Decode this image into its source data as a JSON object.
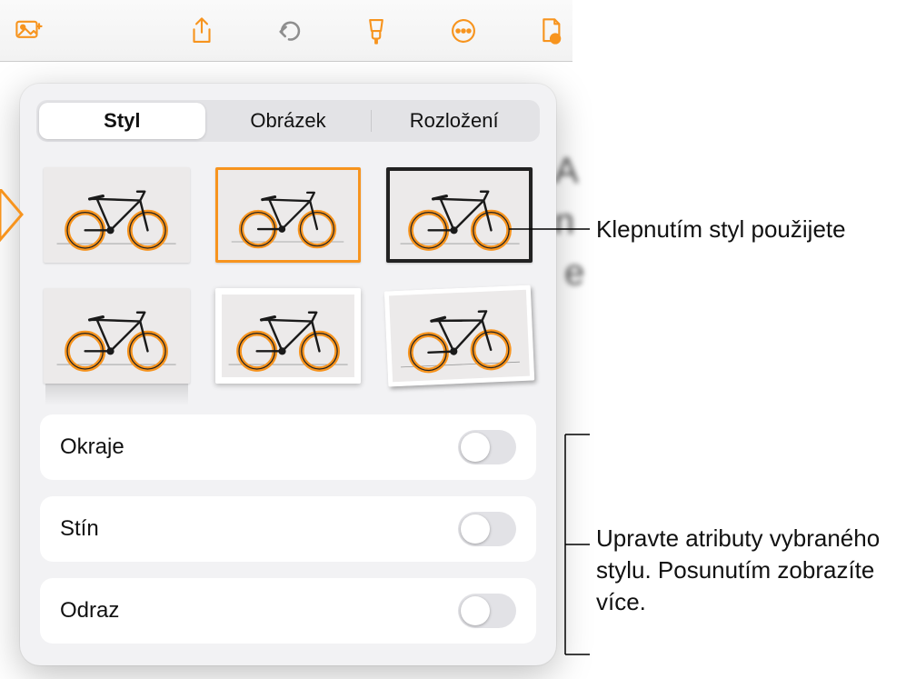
{
  "toolbar": {
    "media_icon": "media-icon",
    "share_icon": "share-icon",
    "undo_icon": "undo-icon",
    "brush_icon": "brush-icon",
    "more_icon": "more-icon",
    "document_icon": "document-view-icon"
  },
  "tabs": {
    "style": "Styl",
    "image": "Obrázek",
    "layout": "Rozložení",
    "selected": "style"
  },
  "style_thumbs": [
    {
      "id": "style-plain",
      "variant": "plain"
    },
    {
      "id": "style-bordered",
      "variant": "bordered"
    },
    {
      "id": "style-frame-dark",
      "variant": "frame-dark"
    },
    {
      "id": "style-reflection",
      "variant": "reflection"
    },
    {
      "id": "style-frame-white",
      "variant": "frame-white"
    },
    {
      "id": "style-tilt",
      "variant": "tilt"
    }
  ],
  "options": {
    "border": {
      "label": "Okraje",
      "value": false
    },
    "shadow": {
      "label": "Stín",
      "value": false
    },
    "reflect": {
      "label": "Odraz",
      "value": false
    }
  },
  "callouts": {
    "apply_style": "Klepnutím styl použijete",
    "edit_attrs": "Upravte atributy vybraného stylu. Posunutím zobrazíte více."
  }
}
